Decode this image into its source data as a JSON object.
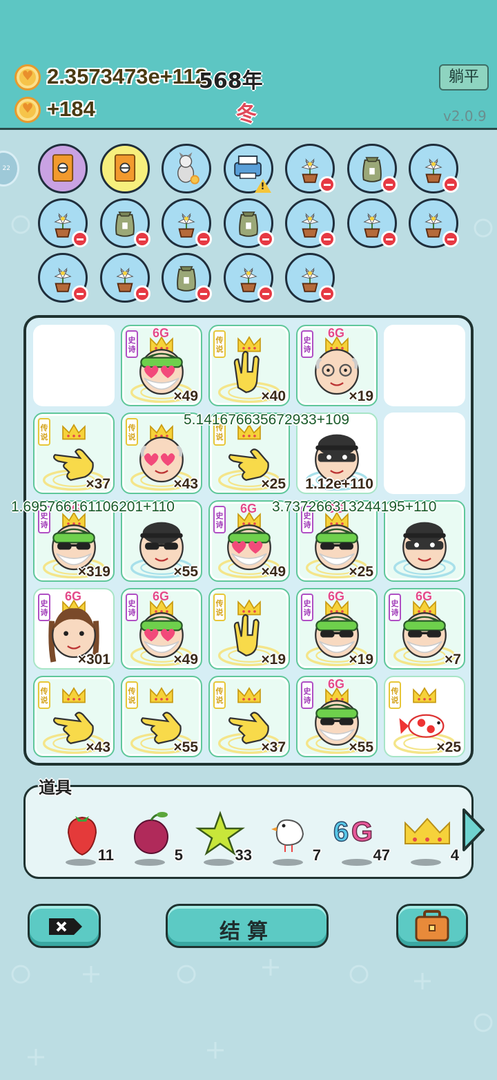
{
  "header": {
    "money_total": "2.3573473e+112",
    "money_rate": "+184",
    "year": "568年",
    "season": "冬",
    "flat_button": "躺平",
    "version": "v2.0.9",
    "side_tab_label": "22"
  },
  "inventory": [
    {
      "icon": "card-pack-icon",
      "color": "purple",
      "badge": "none"
    },
    {
      "icon": "card-pack-icon",
      "color": "yellow",
      "badge": "none"
    },
    {
      "icon": "dog-icon",
      "color": "blue",
      "badge": "coin"
    },
    {
      "icon": "printer-icon",
      "color": "blue",
      "badge": "warning"
    },
    {
      "icon": "flower-pot-icon",
      "color": "blue",
      "badge": "minus"
    },
    {
      "icon": "sack-icon",
      "color": "blue",
      "badge": "minus"
    },
    {
      "icon": "flower-pot-icon",
      "color": "blue",
      "badge": "minus"
    },
    {
      "icon": "flower-pot-icon",
      "color": "blue",
      "badge": "minus"
    },
    {
      "icon": "sack-icon",
      "color": "blue",
      "badge": "minus"
    },
    {
      "icon": "flower-pot-icon",
      "color": "blue",
      "badge": "minus"
    },
    {
      "icon": "sack-icon",
      "color": "blue",
      "badge": "minus"
    },
    {
      "icon": "flower-pot-icon",
      "color": "blue",
      "badge": "minus"
    },
    {
      "icon": "flower-pot-icon",
      "color": "blue",
      "badge": "minus"
    },
    {
      "icon": "flower-pot-icon",
      "color": "blue",
      "badge": "minus"
    },
    {
      "icon": "flower-pot-icon",
      "color": "blue",
      "badge": "minus"
    },
    {
      "icon": "flower-pot-icon",
      "color": "blue",
      "badge": "minus"
    },
    {
      "icon": "sack-icon",
      "color": "blue",
      "badge": "minus"
    },
    {
      "icon": "flower-pot-icon",
      "color": "blue",
      "badge": "minus"
    },
    {
      "icon": "flower-pot-icon",
      "color": "blue",
      "badge": "minus"
    }
  ],
  "board": [
    {
      "type": "empty"
    },
    {
      "type": "hero",
      "char": "elf-heart-icon",
      "rank": "史诗",
      "rank_kind": "epic",
      "tag": "6G",
      "count": "×49"
    },
    {
      "type": "hero",
      "char": "hand-rock-icon",
      "rank": "传说",
      "rank_kind": "legend",
      "tag": "",
      "count": "×40"
    },
    {
      "type": "hero",
      "char": "old-man-glasses-icon",
      "rank": "史诗",
      "rank_kind": "epic",
      "tag": "6G",
      "count": "×19"
    },
    {
      "type": "empty"
    },
    {
      "type": "hero",
      "char": "hand-point-icon",
      "rank": "传说",
      "rank_kind": "legend",
      "tag": "",
      "count": "×37"
    },
    {
      "type": "hero",
      "char": "grandpa-heart-icon",
      "rank": "传说",
      "rank_kind": "legend",
      "tag": "",
      "count": "×43"
    },
    {
      "type": "hero",
      "char": "hand-point-icon",
      "rank": "传说",
      "rank_kind": "legend",
      "tag": "",
      "count": "×25"
    },
    {
      "type": "plain",
      "char": "thief-icon",
      "rank": "",
      "rank_kind": "",
      "tag": "",
      "count": "1.12e+110"
    },
    {
      "type": "empty"
    },
    {
      "type": "hero",
      "char": "elf-sunglasses-icon",
      "rank": "史诗",
      "rank_kind": "epic",
      "tag": "6G",
      "count": "×319"
    },
    {
      "type": "hero",
      "char": "thief-heart-icon",
      "rank": "",
      "rank_kind": "",
      "tag": "",
      "count": "×55"
    },
    {
      "type": "hero",
      "char": "elf-heart-icon",
      "rank": "史诗",
      "rank_kind": "epic",
      "tag": "6G",
      "count": "×49"
    },
    {
      "type": "hero",
      "char": "elf-sunglasses-icon",
      "rank": "史诗",
      "rank_kind": "epic",
      "tag": "6G",
      "count": "×25"
    },
    {
      "type": "hero",
      "char": "thief-icon",
      "rank": "",
      "rank_kind": "",
      "tag": "",
      "count": ""
    },
    {
      "type": "plain",
      "char": "girl-braids-icon",
      "rank": "史诗",
      "rank_kind": "epic",
      "tag": "6G",
      "count": "×301"
    },
    {
      "type": "hero",
      "char": "elf-heart-icon",
      "rank": "史诗",
      "rank_kind": "epic",
      "tag": "6G",
      "count": "×49"
    },
    {
      "type": "hero",
      "char": "hand-rock-icon",
      "rank": "传说",
      "rank_kind": "legend",
      "tag": "",
      "count": "×19"
    },
    {
      "type": "hero",
      "char": "elf-sunglasses-icon",
      "rank": "史诗",
      "rank_kind": "epic",
      "tag": "6G",
      "count": "×19"
    },
    {
      "type": "hero",
      "char": "elf-sunglasses-icon",
      "rank": "史诗",
      "rank_kind": "epic",
      "tag": "6G",
      "count": "×7"
    },
    {
      "type": "hero",
      "char": "hand-point-icon",
      "rank": "传说",
      "rank_kind": "legend",
      "tag": "",
      "count": "×43"
    },
    {
      "type": "hero",
      "char": "hand-point-icon",
      "rank": "传说",
      "rank_kind": "legend",
      "tag": "",
      "count": "×55"
    },
    {
      "type": "hero",
      "char": "hand-point-icon",
      "rank": "传说",
      "rank_kind": "legend",
      "tag": "",
      "count": "×37"
    },
    {
      "type": "hero",
      "char": "elf-sunglasses-icon",
      "rank": "史诗",
      "rank_kind": "epic",
      "tag": "6G",
      "count": "×55"
    },
    {
      "type": "plain",
      "char": "koi-fish-icon",
      "rank": "传说",
      "rank_kind": "legend",
      "tag": "",
      "count": "×25"
    }
  ],
  "floating_numbers": [
    "5.141676635672933+109",
    "1.695766161106201+110",
    "3.737266313244195+110"
  ],
  "items_label": "道具",
  "items": [
    {
      "icon": "strawberry-icon",
      "qty": "11"
    },
    {
      "icon": "bayberry-icon",
      "qty": "5"
    },
    {
      "icon": "star-icon",
      "qty": "33"
    },
    {
      "icon": "white-bird-icon",
      "qty": "7"
    },
    {
      "icon": "6g-icon",
      "label": "6G",
      "qty": "47"
    },
    {
      "icon": "crown-icon",
      "qty": "4"
    }
  ],
  "bottom": {
    "close_icon": "close-x-icon",
    "settle_label": "结算",
    "bag_icon": "briefcase-icon"
  },
  "colors": {
    "header_bg": "#5dc6c3",
    "page_bg": "#bcdde3",
    "epic": "#b04fc4",
    "legend": "#e7c639",
    "button": "#5ccac4"
  }
}
